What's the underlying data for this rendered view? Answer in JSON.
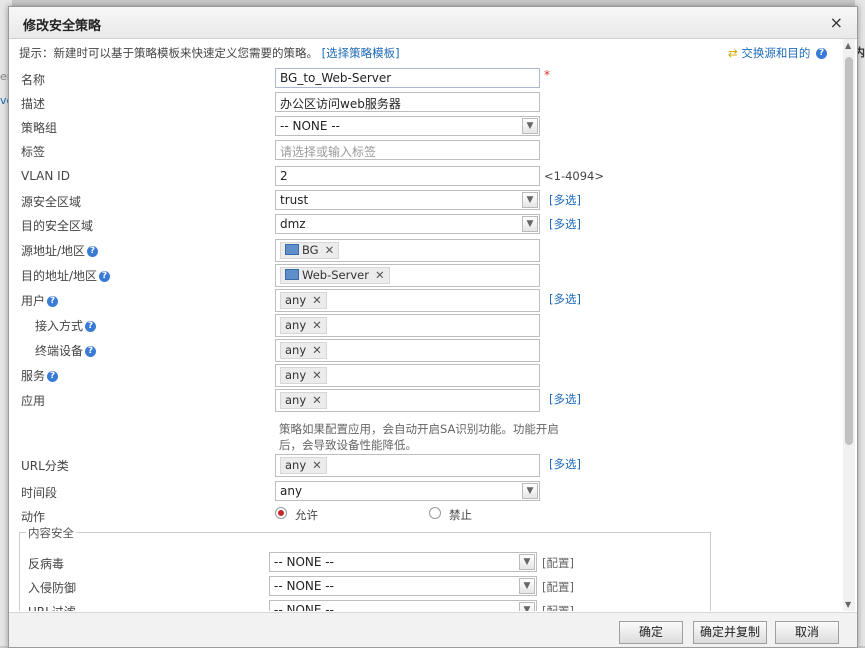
{
  "dialog": {
    "title": "修改安全策略",
    "close_glyph": "×"
  },
  "background": {
    "left_text1": "er",
    "left_text2": "ve",
    "right_text": "内"
  },
  "hint": {
    "text": "提示：新建时可以基于策略模板来快速定义您需要的策略。",
    "link": "[选择策略模板]"
  },
  "swap": {
    "label": "交换源和目的"
  },
  "form": {
    "name": {
      "label": "名称",
      "value": "BG_to_Web-Server",
      "required": "*"
    },
    "desc": {
      "label": "描述",
      "value": "办公区访问web服务器"
    },
    "group": {
      "label": "策略组",
      "value": "-- NONE --"
    },
    "tag": {
      "label": "标签",
      "placeholder": "请选择或输入标签"
    },
    "vlan": {
      "label": "VLAN ID",
      "value": "2",
      "range": "<1-4094>"
    },
    "src_zone": {
      "label": "源安全区域",
      "value": "trust",
      "multi": "[多选]"
    },
    "dst_zone": {
      "label": "目的安全区域",
      "value": "dmz",
      "multi": "[多选]"
    },
    "src_addr": {
      "label": "源地址/地区",
      "tag": "BG"
    },
    "dst_addr": {
      "label": "目的地址/地区",
      "tag": "Web-Server"
    },
    "user": {
      "label": "用户",
      "tag": "any",
      "multi": "[多选]"
    },
    "access": {
      "label": "接入方式",
      "tag": "any"
    },
    "device": {
      "label": "终端设备",
      "tag": "any"
    },
    "service": {
      "label": "服务",
      "tag": "any"
    },
    "app": {
      "label": "应用",
      "tag": "any",
      "multi": "[多选]"
    },
    "app_note": "策略如果配置应用，会自动开启SA识别功能。功能开启后，会导致设备性能降低。",
    "url_cat": {
      "label": "URL分类",
      "tag": "any",
      "multi": "[多选]"
    },
    "time": {
      "label": "时间段",
      "value": "any"
    },
    "action": {
      "label": "动作",
      "allow": "允许",
      "deny": "禁止"
    }
  },
  "content_security": {
    "legend": "内容安全",
    "rows": [
      {
        "label": "反病毒",
        "value": "-- NONE --",
        "cfg": "[配置]"
      },
      {
        "label": "入侵防御",
        "value": "-- NONE --",
        "cfg": "[配置]"
      },
      {
        "label": "URL过滤",
        "value": "-- NONE --",
        "cfg": "[配置]"
      }
    ]
  },
  "buttons": {
    "ok": "确定",
    "ok_copy": "确定并复制",
    "cancel": "取消"
  },
  "colors": {
    "link": "#1f6bb8",
    "required": "#dd3333",
    "radio_on": "#c62828"
  }
}
